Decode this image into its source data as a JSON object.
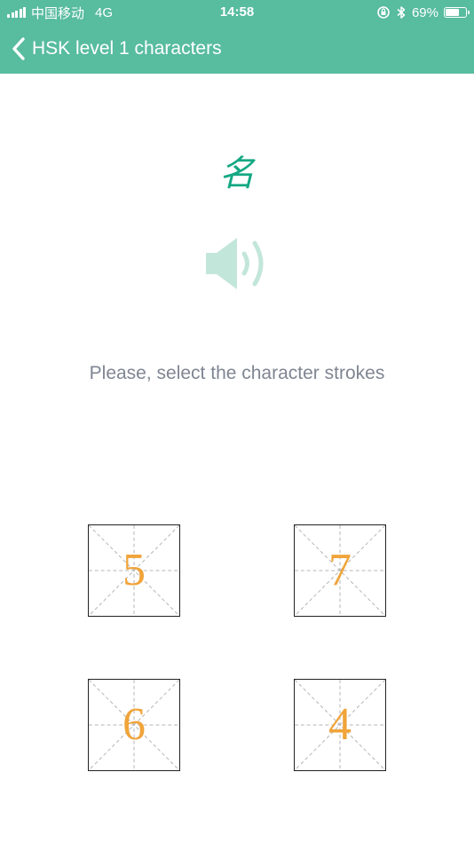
{
  "status_bar": {
    "carrier": "中国移动",
    "network": "4G",
    "time": "14:58",
    "battery_percent": "69%",
    "battery_level": 0.69,
    "signal_bars": 4
  },
  "nav": {
    "back_icon": "chevron-left-icon",
    "title": "HSK level 1 characters"
  },
  "question": {
    "character": "名",
    "speaker_icon": "speaker-icon",
    "prompt": "Please, select the character strokes"
  },
  "options": [
    "5",
    "7",
    "6",
    "4"
  ],
  "colors": {
    "header": "#58bc9f",
    "character": "#13a883",
    "speaker": "#c3e6db",
    "prompt": "#7f8692",
    "option_number": "#f0a43a",
    "option_border": "#222222",
    "grid_guides": "#b5b5b5"
  }
}
